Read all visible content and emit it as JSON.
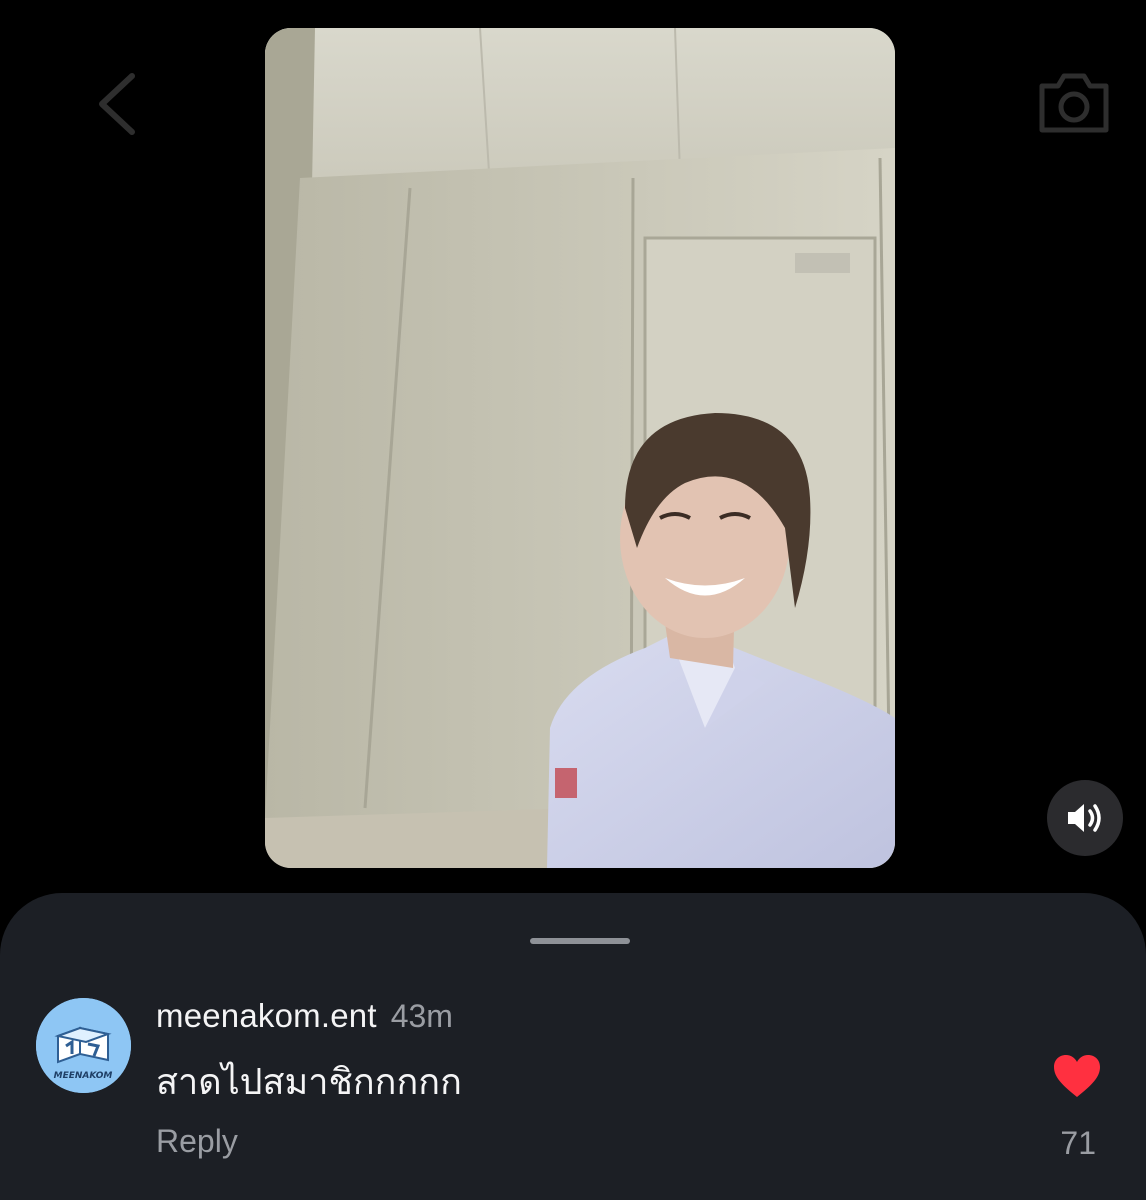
{
  "nav": {
    "back_icon": "chevron-left-icon",
    "camera_icon": "camera-icon"
  },
  "video": {
    "sound_icon": "speaker-volume-icon"
  },
  "colors": {
    "sheet_background": "#1c1f25",
    "heart": "#ff3040",
    "avatar_background": "#8ec6f4",
    "muted_text": "#9a9da3"
  },
  "comment": {
    "avatar_text": "MEENAKOM",
    "username": "meenakom.ent",
    "time": "43m",
    "text": "สาดไปสมาชิกกกกก",
    "reply_label": "Reply",
    "like_count": "71",
    "liked": true
  }
}
